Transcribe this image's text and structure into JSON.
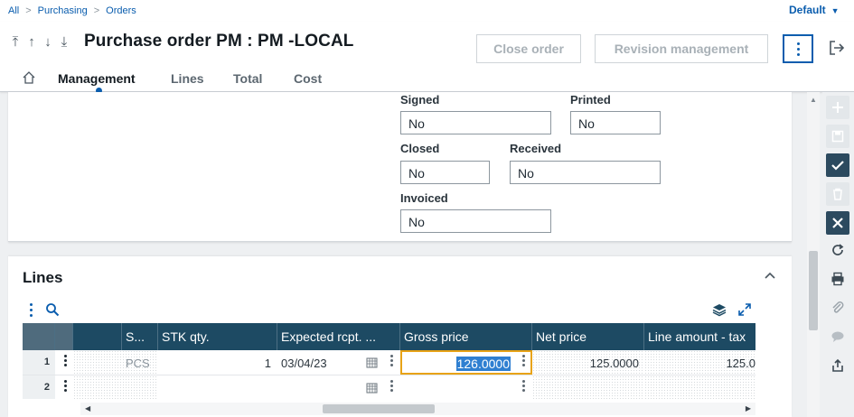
{
  "breadcrumb": {
    "items": [
      "All",
      "Purchasing",
      "Orders"
    ]
  },
  "user_menu": {
    "label": "Default"
  },
  "header": {
    "title": "Purchase order PM : PM -LOCAL",
    "close_order_label": "Close order",
    "revision_label": "Revision management"
  },
  "tabs": [
    "Management",
    "Lines",
    "Total",
    "Cost"
  ],
  "status": {
    "signed_label": "Signed",
    "signed_value": "No",
    "printed_label": "Printed",
    "printed_value": "No",
    "closed_label": "Closed",
    "closed_value": "No",
    "received_label": "Received",
    "received_value": "No",
    "invoiced_label": "Invoiced",
    "invoiced_value": "No"
  },
  "lines_section": {
    "title": "Lines",
    "columns": [
      "S...",
      "STK qty.",
      "Expected rcpt. ...",
      "Gross price",
      "Net price",
      "Line amount - tax"
    ],
    "rows": [
      {
        "num": "1",
        "unit": "PCS",
        "qty": "1",
        "date": "03/04/23",
        "gross": "126.0000",
        "net": "125.0000",
        "amount": "125.0"
      },
      {
        "num": "2",
        "unit": "",
        "qty": "",
        "date": "",
        "gross": "",
        "net": "",
        "amount": ""
      }
    ]
  },
  "colors": {
    "accent": "#0a5dae",
    "grid_header": "#1d4a63",
    "edit_border": "#e8a317",
    "toolbar_dark": "#2c4a5f"
  }
}
